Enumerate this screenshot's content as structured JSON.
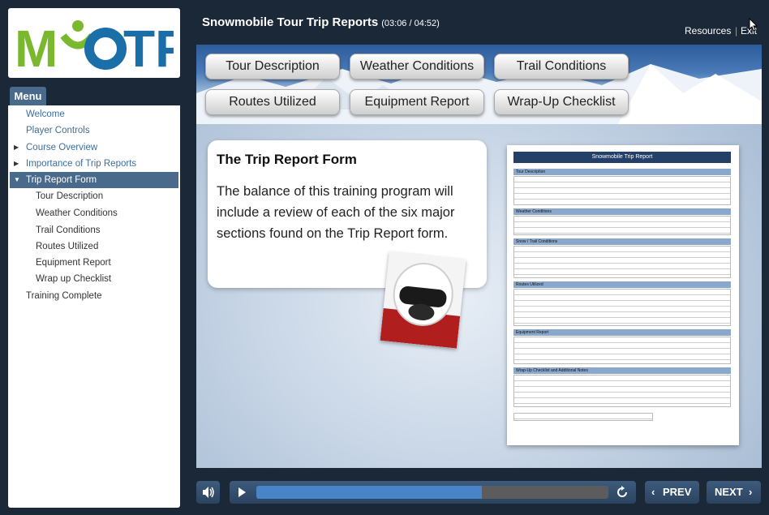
{
  "logo": {
    "text": "MYOTF"
  },
  "menu": {
    "tab_label": "Menu",
    "items": [
      {
        "label": "Welcome"
      },
      {
        "label": "Player Controls"
      },
      {
        "label": "Course Overview"
      },
      {
        "label": "Importance of Trip Reports"
      },
      {
        "label": "Trip Report Form"
      },
      {
        "label": "Tour Description"
      },
      {
        "label": "Weather Conditions"
      },
      {
        "label": "Trail Conditions"
      },
      {
        "label": "Routes Utilized"
      },
      {
        "label": "Equipment Report"
      },
      {
        "label": "Wrap up Checklist"
      },
      {
        "label": "Training Complete"
      }
    ]
  },
  "header": {
    "title": "Snowmobile Tour Trip Reports",
    "time": "(03:06 / 04:52)",
    "resources_label": "Resources",
    "exit_label": "Exit"
  },
  "stage": {
    "nav_buttons": [
      {
        "label": "Tour Description"
      },
      {
        "label": "Weather Conditions"
      },
      {
        "label": "Trail Conditions"
      },
      {
        "label": "Routes Utilized"
      },
      {
        "label": "Equipment Report"
      },
      {
        "label": "Wrap-Up Checklist"
      }
    ],
    "callout_title": "The Trip Report Form",
    "callout_body": "The balance of this training program will include a review of each of the six major sections found on the Trip Report form.",
    "doc": {
      "title": "Snowmobile Trip Report",
      "sections": [
        "Tour Description",
        "Weather Conditions",
        "Snow / Trail Conditions",
        "Routes Utilized",
        "Equipment Report",
        "Wrap-Up Checklist and Additional Notes"
      ]
    }
  },
  "player": {
    "prev_label": "PREV",
    "next_label": "NEXT",
    "progress": 0.64
  },
  "colors": {
    "accent": "#4a84c8",
    "menu_active": "#4a6a8c",
    "background": "#1b2838"
  }
}
